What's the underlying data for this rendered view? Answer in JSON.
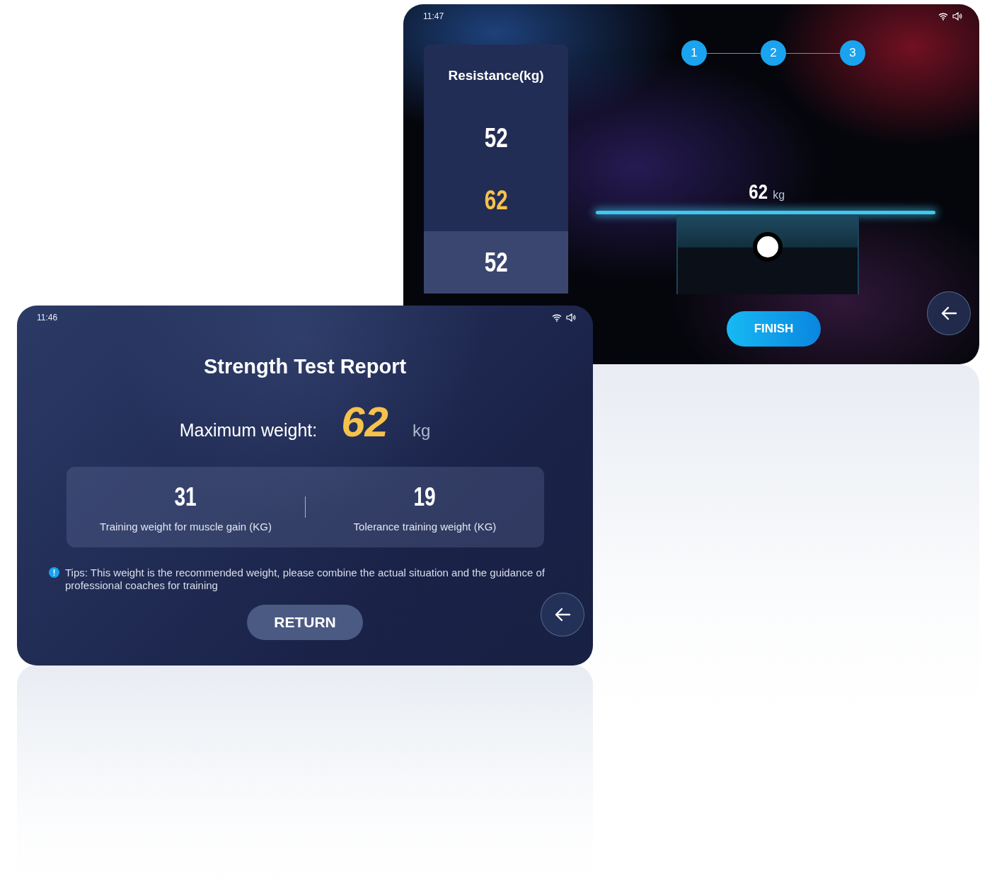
{
  "resistance_screen": {
    "time": "11:47",
    "picker": {
      "title": "Resistance(kg)",
      "items": [
        {
          "value": "52",
          "selected": false,
          "highlighted": false
        },
        {
          "value": "62",
          "selected": true,
          "highlighted": false
        },
        {
          "value": "52",
          "selected": false,
          "highlighted": true
        }
      ]
    },
    "steps": [
      "1",
      "2",
      "3"
    ],
    "reading": {
      "value": "62",
      "unit": "kg"
    },
    "finish_button": "FINISH"
  },
  "report_screen": {
    "time": "11:46",
    "title": "Strength Test Report",
    "max_weight": {
      "label": "Maximum weight:",
      "value": "62",
      "unit": "kg"
    },
    "stats": [
      {
        "value": "31",
        "label": "Training weight for muscle gain (KG)"
      },
      {
        "value": "19",
        "label": "Tolerance training weight (KG)"
      }
    ],
    "tip": "Tips: This weight is the recommended weight, please combine the actual situation and the guidance of professional coaches for training",
    "return_button": "RETURN"
  }
}
